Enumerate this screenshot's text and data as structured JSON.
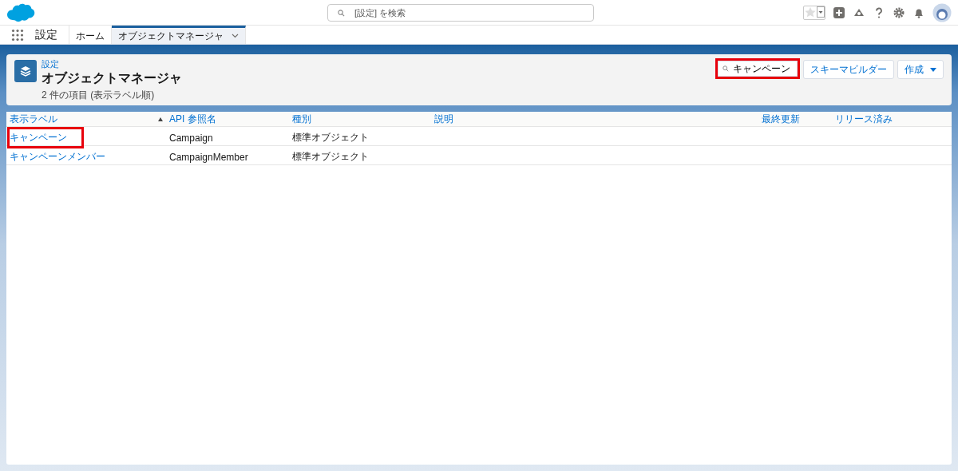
{
  "header": {
    "search": {
      "placeholder": "[設定] を検索"
    }
  },
  "nav": {
    "app_name": "設定",
    "tabs": [
      {
        "label": "ホーム",
        "selected": false,
        "has_menu": false
      },
      {
        "label": "オブジェクトマネージャ",
        "selected": true,
        "has_menu": true
      }
    ]
  },
  "page_header": {
    "breadcrumb": "設定",
    "title": "オブジェクトマネージャ",
    "subtitle": "2 件の項目 (表示ラベル順)",
    "search": {
      "value": "キャンペーン",
      "highlighted": true
    },
    "buttons": [
      {
        "label": "スキーマビルダー",
        "kind": "plain"
      },
      {
        "label": "作成",
        "kind": "menu"
      }
    ]
  },
  "table": {
    "columns": [
      {
        "label": "表示ラベル",
        "sorted": true
      },
      {
        "label": "API 参照名",
        "sorted": false
      },
      {
        "label": "種別",
        "sorted": false
      },
      {
        "label": "説明",
        "sorted": false
      },
      {
        "label": "最終更新",
        "sorted": false
      },
      {
        "label": "リリース済み",
        "sorted": false
      }
    ],
    "rows": [
      {
        "label": "キャンペーン",
        "highlighted": true,
        "api_name": "Campaign",
        "type": "標準オブジェクト"
      },
      {
        "label": "キャンペーンメンバー",
        "highlighted": false,
        "api_name": "CampaignMember",
        "type": "標準オブジェクト"
      }
    ]
  }
}
